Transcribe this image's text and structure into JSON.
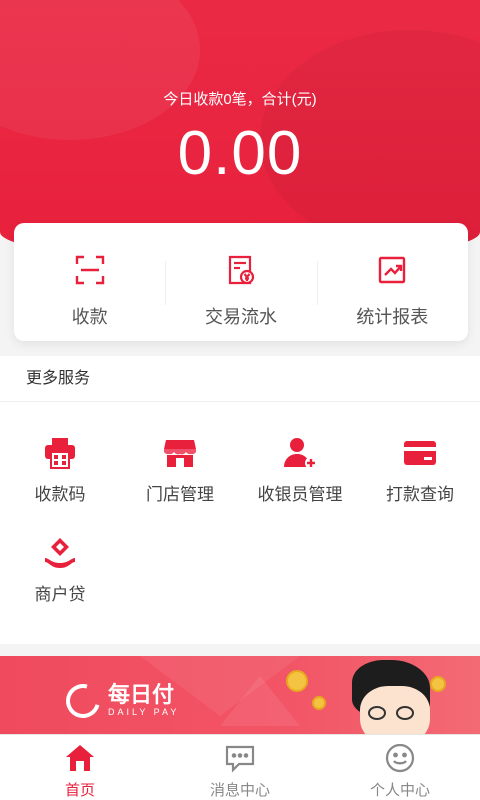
{
  "header": {
    "summary": "今日收款0笔，合计(元)",
    "amount": "0.00"
  },
  "quick_actions": [
    {
      "label": "收款",
      "icon": "scan-icon"
    },
    {
      "label": "交易流水",
      "icon": "receipt-yen-icon"
    },
    {
      "label": "统计报表",
      "icon": "chart-trend-icon"
    }
  ],
  "services": {
    "title": "更多服务",
    "items": [
      {
        "label": "收款码",
        "icon": "qr-printer-icon"
      },
      {
        "label": "门店管理",
        "icon": "store-icon"
      },
      {
        "label": "收银员管理",
        "icon": "add-user-icon"
      },
      {
        "label": "打款查询",
        "icon": "card-icon"
      },
      {
        "label": "商户贷",
        "icon": "loan-icon"
      }
    ]
  },
  "banner": {
    "brand_cn": "每日付",
    "brand_en": "DAILY PAY"
  },
  "tabbar": {
    "items": [
      {
        "label": "首页",
        "icon": "home-icon",
        "active": true
      },
      {
        "label": "消息中心",
        "icon": "message-icon",
        "active": false
      },
      {
        "label": "个人中心",
        "icon": "smiley-icon",
        "active": false
      }
    ]
  },
  "colors": {
    "brand_red": "#e8203c",
    "text_gray": "#555555"
  }
}
